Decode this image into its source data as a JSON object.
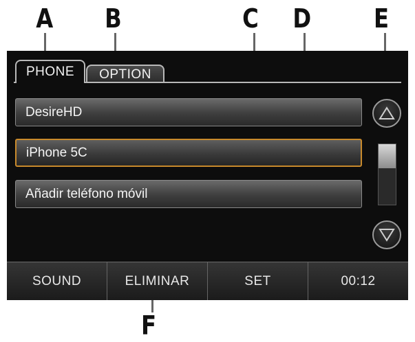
{
  "callouts": [
    "A",
    "B",
    "C",
    "D",
    "E",
    "F"
  ],
  "tabs": [
    {
      "label": "PHONE",
      "active": true
    },
    {
      "label": "OPTION",
      "active": false
    }
  ],
  "phone_list": [
    {
      "label": "DesireHD",
      "selected": false
    },
    {
      "label": "iPhone 5C",
      "selected": true
    },
    {
      "label": "Añadir teléfono móvil",
      "selected": false
    }
  ],
  "scrollbar": {
    "up_icon": "triangle-up-icon",
    "down_icon": "triangle-down-icon",
    "position_fraction": 0
  },
  "bottom_bar": {
    "sound": "SOUND",
    "eliminar": "ELIMINAR",
    "set": "SET",
    "time": "00:12"
  },
  "colors": {
    "screen_bg": "#0d0d0d",
    "selected_border": "#c98a2c",
    "text": "#f2f2f2"
  }
}
